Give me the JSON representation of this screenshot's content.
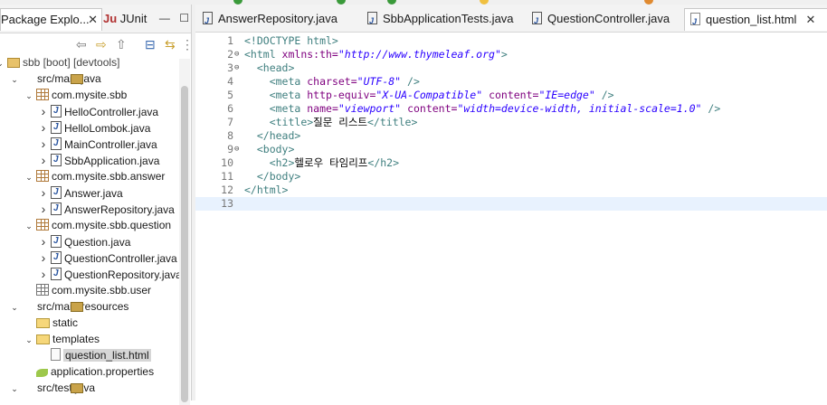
{
  "left_panel": {
    "tabs": [
      {
        "label": "Package Explo...",
        "closable": true
      },
      {
        "label": "JUnit",
        "closable": false
      }
    ],
    "tree": [
      {
        "label": "sbb [boot] [devtools]",
        "icon": "project-icon",
        "twisty": "v",
        "indent": 0
      },
      {
        "label": "src/main/java",
        "icon": "source-folder-icon",
        "twisty": "v",
        "indent": 1
      },
      {
        "label": "com.mysite.sbb",
        "icon": "package-icon",
        "twisty": "v",
        "indent": 2
      },
      {
        "label": "HelloController.java",
        "icon": "java-file-icon",
        "twisty": ">",
        "indent": 3
      },
      {
        "label": "HelloLombok.java",
        "icon": "java-file-icon",
        "twisty": ">",
        "indent": 3
      },
      {
        "label": "MainController.java",
        "icon": "java-file-icon",
        "twisty": ">",
        "indent": 3
      },
      {
        "label": "SbbApplication.java",
        "icon": "java-file-icon",
        "twisty": ">",
        "indent": 3
      },
      {
        "label": "com.mysite.sbb.answer",
        "icon": "package-icon",
        "twisty": "v",
        "indent": 2
      },
      {
        "label": "Answer.java",
        "icon": "java-file-icon",
        "twisty": ">",
        "indent": 3
      },
      {
        "label": "AnswerRepository.java",
        "icon": "java-file-icon",
        "twisty": ">",
        "indent": 3
      },
      {
        "label": "com.mysite.sbb.question",
        "icon": "package-icon",
        "twisty": "v",
        "indent": 2
      },
      {
        "label": "Question.java",
        "icon": "java-file-icon",
        "twisty": ">",
        "indent": 3
      },
      {
        "label": "QuestionController.java",
        "icon": "java-file-icon",
        "twisty": ">",
        "indent": 3
      },
      {
        "label": "QuestionRepository.java",
        "icon": "java-file-icon",
        "twisty": ">",
        "indent": 3
      },
      {
        "label": "com.mysite.sbb.user",
        "icon": "empty-package-icon",
        "twisty": "",
        "indent": 2
      },
      {
        "label": "src/main/resources",
        "icon": "source-folder-icon",
        "twisty": "v",
        "indent": 1
      },
      {
        "label": "static",
        "icon": "folder-icon",
        "twisty": "",
        "indent": 2
      },
      {
        "label": "templates",
        "icon": "folder-icon",
        "twisty": "v",
        "indent": 2
      },
      {
        "label": "question_list.html",
        "icon": "html-file-icon",
        "twisty": "",
        "indent": 3,
        "selected": true
      },
      {
        "label": "application.properties",
        "icon": "properties-file-icon",
        "twisty": "",
        "indent": 2
      },
      {
        "label": "src/test/java",
        "icon": "source-folder-icon",
        "twisty": "v",
        "indent": 1
      }
    ]
  },
  "editor": {
    "tabs": [
      {
        "label": "AnswerRepository.java",
        "active": false
      },
      {
        "label": "SbbApplicationTests.java",
        "active": false
      },
      {
        "label": "QuestionController.java",
        "active": false
      },
      {
        "label": "question_list.html",
        "active": true
      }
    ],
    "lines": [
      {
        "n": "1",
        "fold": "",
        "indent": "",
        "parts": [
          [
            "t",
            "<!DOCTYPE html>"
          ]
        ]
      },
      {
        "n": "2",
        "fold": "⊖",
        "indent": "",
        "parts": [
          [
            "t",
            "<html "
          ],
          [
            "a",
            "xmlns:th="
          ],
          [
            "v",
            "\"http://www.thymeleaf.org\""
          ],
          [
            "t",
            ">"
          ]
        ]
      },
      {
        "n": "3",
        "fold": "⊖",
        "indent": "  ",
        "parts": [
          [
            "t",
            "<head>"
          ]
        ]
      },
      {
        "n": "4",
        "fold": "",
        "indent": "    ",
        "parts": [
          [
            "t",
            "<meta "
          ],
          [
            "a",
            "charset="
          ],
          [
            "v",
            "\"UTF-8\""
          ],
          [
            "t",
            " />"
          ]
        ]
      },
      {
        "n": "5",
        "fold": "",
        "indent": "    ",
        "parts": [
          [
            "t",
            "<meta "
          ],
          [
            "a",
            "http-equiv="
          ],
          [
            "v",
            "\"X-UA-Compatible\""
          ],
          [
            "t",
            " "
          ],
          [
            "a",
            "content="
          ],
          [
            "v",
            "\"IE=edge\""
          ],
          [
            "t",
            " />"
          ]
        ]
      },
      {
        "n": "6",
        "fold": "",
        "indent": "    ",
        "parts": [
          [
            "t",
            "<meta "
          ],
          [
            "a",
            "name="
          ],
          [
            "v",
            "\"viewport\""
          ],
          [
            "t",
            " "
          ],
          [
            "a",
            "content="
          ],
          [
            "v",
            "\"width=device-width, initial-scale=1.0\""
          ],
          [
            "t",
            " />"
          ]
        ]
      },
      {
        "n": "7",
        "fold": "",
        "indent": "    ",
        "parts": [
          [
            "t",
            "<title>"
          ],
          [
            "txt",
            "질문 리스트"
          ],
          [
            "t",
            "</title>"
          ]
        ]
      },
      {
        "n": "8",
        "fold": "",
        "indent": "  ",
        "parts": [
          [
            "t",
            "</head>"
          ]
        ]
      },
      {
        "n": "9",
        "fold": "⊖",
        "indent": "  ",
        "parts": [
          [
            "t",
            "<body>"
          ]
        ]
      },
      {
        "n": "10",
        "fold": "",
        "indent": "    ",
        "parts": [
          [
            "t",
            "<h2>"
          ],
          [
            "txt",
            "헬로우 타임리프"
          ],
          [
            "t",
            "</h2>"
          ]
        ]
      },
      {
        "n": "11",
        "fold": "",
        "indent": "  ",
        "parts": [
          [
            "t",
            "</body>"
          ]
        ]
      },
      {
        "n": "12",
        "fold": "",
        "indent": "",
        "parts": [
          [
            "t",
            "</html>"
          ]
        ]
      },
      {
        "n": "13",
        "fold": "",
        "indent": "",
        "parts": [],
        "current": true
      }
    ]
  }
}
